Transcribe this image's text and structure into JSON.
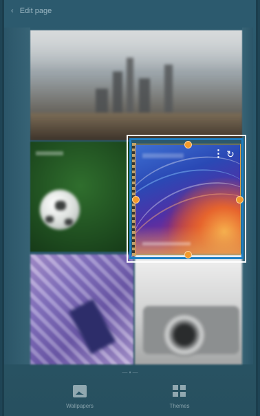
{
  "header": {
    "back_icon": "‹",
    "title": "Edit page"
  },
  "widget": {
    "more_icon": "⋮",
    "refresh_icon": "↻"
  },
  "page_indicator": "— ▪ —",
  "bottom_bar": {
    "items": [
      {
        "icon": "wallpaper-icon",
        "label": "Wallpapers"
      },
      {
        "icon": "themes-grid-icon",
        "label": "Themes"
      }
    ]
  },
  "colors": {
    "selection_outer": "#ffffff",
    "selection_inner": "#1c7fc4",
    "resize_handle": "#f39a2c",
    "background": "#2c5a6e"
  }
}
